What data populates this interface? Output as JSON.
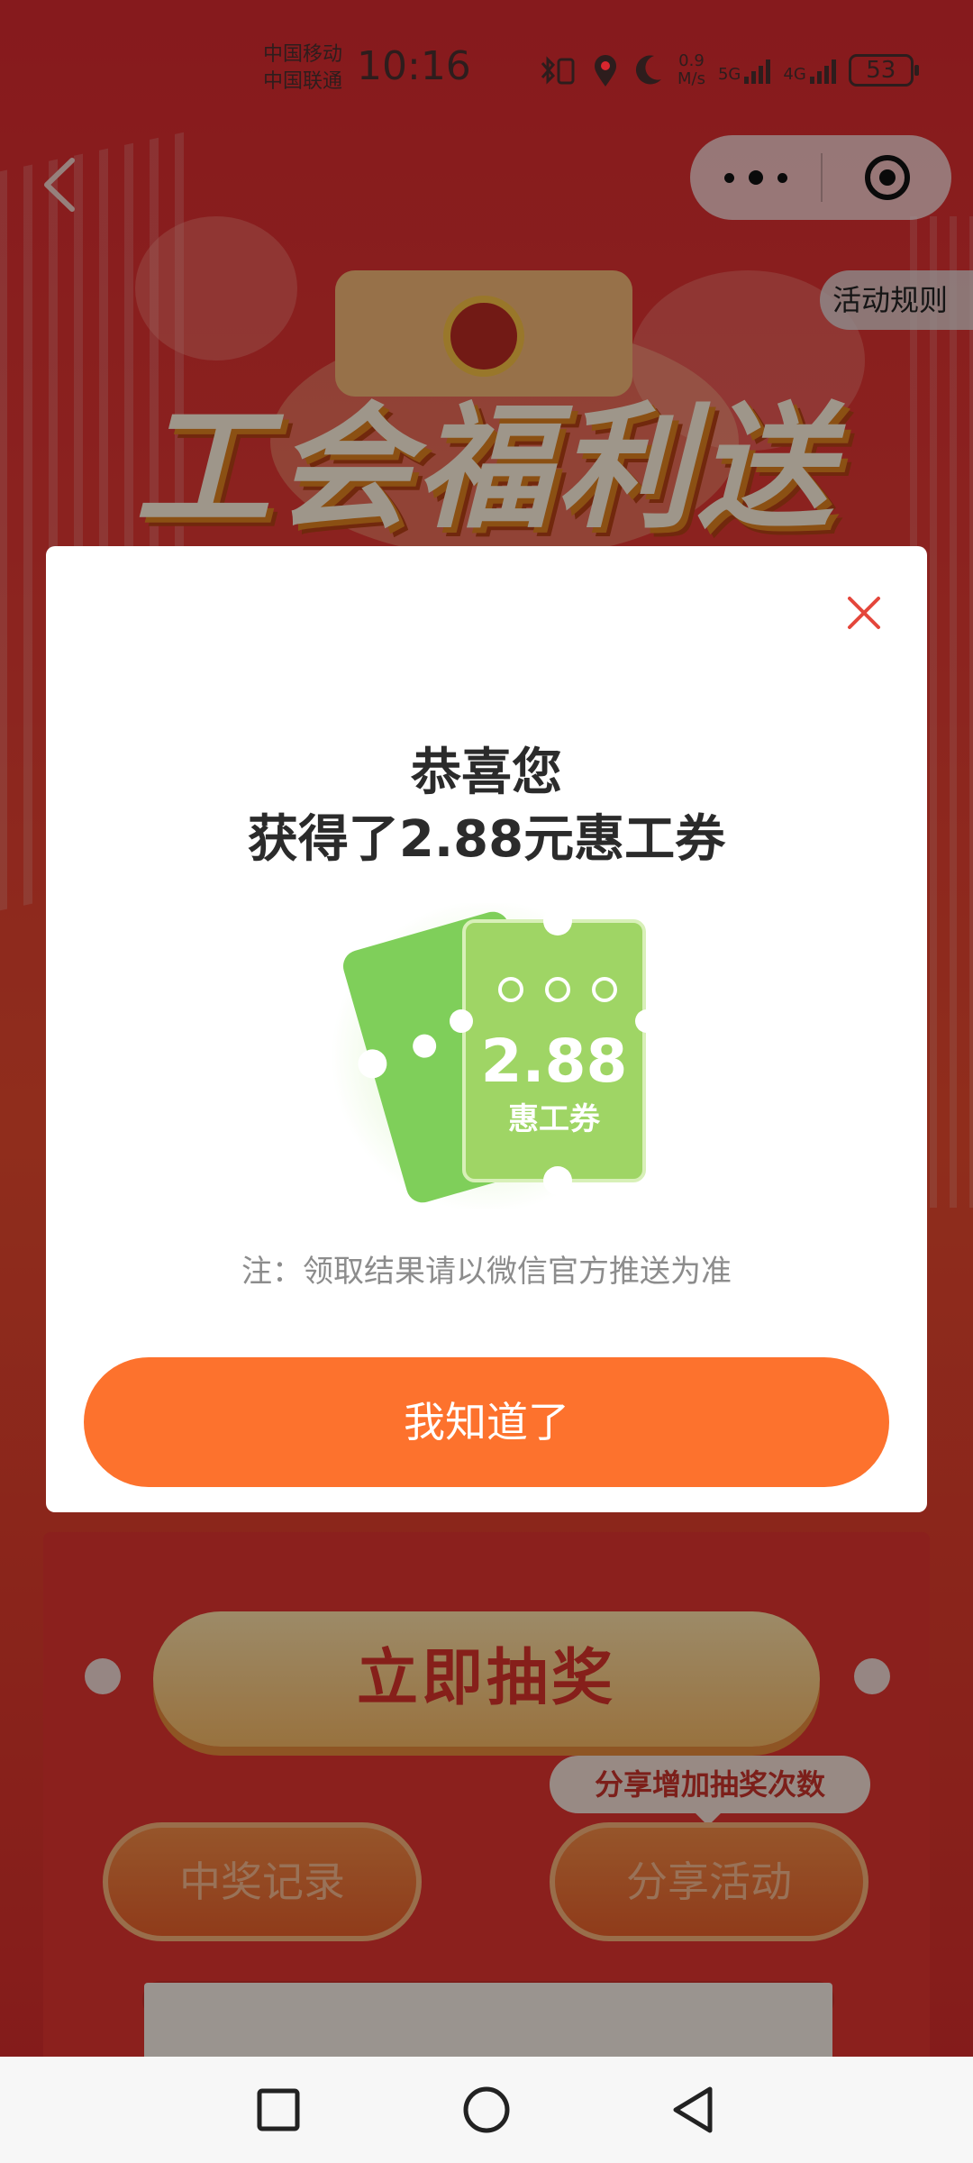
{
  "status_bar": {
    "carrier_1": "中国移动",
    "carrier_2": "中国联通",
    "time": "10:16",
    "net_speed_value": "0.9",
    "net_speed_unit": "M/s",
    "signal_1": "5G",
    "signal_2": "4G",
    "battery": "53"
  },
  "header": {
    "banner_title": "工会福利送",
    "rules_label": "活动规则"
  },
  "modal": {
    "title": "恭喜您",
    "subtitle": "获得了2.88元惠工券",
    "coupon_value": "2.88",
    "coupon_label": "惠工券",
    "note": "注：领取结果请以微信官方推送为准",
    "confirm_label": "我知道了"
  },
  "lottery": {
    "draw_label": "立即抽奖",
    "share_tip": "分享增加抽奖次数",
    "records_label": "中奖记录",
    "share_label": "分享活动"
  },
  "colors": {
    "accent": "#fd722d",
    "page_red": "#d8262e",
    "coupon_green": "#9fd565"
  },
  "icons": {
    "back": "chevron-left-icon",
    "more": "more-dots-icon",
    "close_miniprogram": "target-circle-icon",
    "modal_close": "close-icon",
    "nav_recent": "square-icon",
    "nav_home": "circle-icon",
    "nav_back": "triangle-back-icon"
  }
}
